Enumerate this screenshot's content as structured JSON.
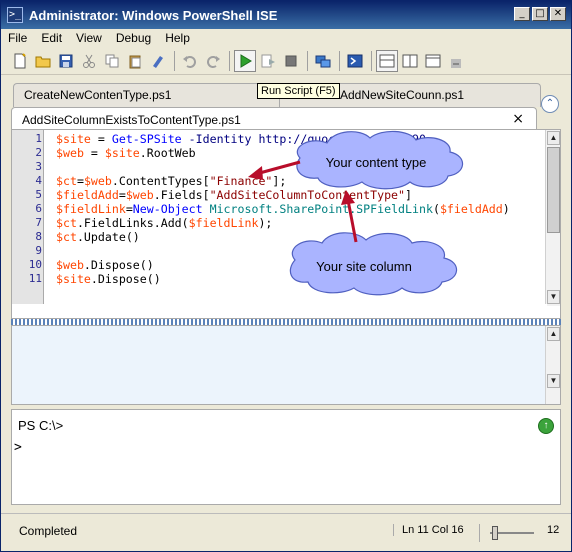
{
  "window": {
    "title": "Administrator: Windows PowerShell ISE",
    "app_icon_glyph": ">_"
  },
  "title_buttons": {
    "minimize": "_",
    "maximize": "□",
    "close": "✕"
  },
  "menu": [
    "File",
    "Edit",
    "View",
    "Debug",
    "Help"
  ],
  "toolbar": {
    "tools": [
      "new-icon",
      "open-icon",
      "save-icon",
      "cut-icon",
      "copy-icon",
      "paste-icon",
      "clear-icon",
      "undo-icon",
      "redo-icon",
      "run-icon",
      "run-selection-icon",
      "stop-icon",
      "remote-icon",
      "powershell-icon",
      "layout-top-icon",
      "layout-right-icon",
      "layout-max-icon"
    ],
    "tooltip": "Run Script (F5)"
  },
  "tabs": {
    "inactive": [
      "CreateNewContenType.ps1",
      "AddNewSiteCounn.ps1"
    ],
    "active": "AddSiteColumnExistsToContentType.ps1",
    "close_glyph": "×",
    "collapse_glyph": "⌃"
  },
  "editor": {
    "line_numbers": [
      "1",
      "2",
      "3",
      "4",
      "5",
      "6",
      "7",
      "8",
      "9",
      "10",
      "11"
    ],
    "lines": [
      [
        {
          "t": "$site",
          "c": "var"
        },
        {
          "t": " = ",
          "c": "plain"
        },
        {
          "t": "Get-SPSite",
          "c": "cmd"
        },
        {
          "t": " -Identity ",
          "c": "param"
        },
        {
          "t": "http://quochung-axioo:90",
          "c": "param"
        }
      ],
      [
        {
          "t": "$web",
          "c": "var"
        },
        {
          "t": " = ",
          "c": "plain"
        },
        {
          "t": "$site",
          "c": "var"
        },
        {
          "t": ".RootWeb",
          "c": "plain"
        }
      ],
      [],
      [
        {
          "t": "$ct",
          "c": "var"
        },
        {
          "t": "=",
          "c": "plain"
        },
        {
          "t": "$web",
          "c": "var"
        },
        {
          "t": ".ContentTypes[",
          "c": "plain"
        },
        {
          "t": "\"Finance\"",
          "c": "str"
        },
        {
          "t": "];",
          "c": "plain"
        }
      ],
      [
        {
          "t": "$fieldAdd",
          "c": "var"
        },
        {
          "t": "=",
          "c": "plain"
        },
        {
          "t": "$web",
          "c": "var"
        },
        {
          "t": ".Fields[",
          "c": "plain"
        },
        {
          "t": "\"AddSiteColumnToContentType\"",
          "c": "str"
        },
        {
          "t": "]",
          "c": "plain"
        }
      ],
      [
        {
          "t": "$fieldLink",
          "c": "var"
        },
        {
          "t": "=",
          "c": "plain"
        },
        {
          "t": "New-Object",
          "c": "cmd"
        },
        {
          "t": " Microsoft.SharePoint.SPFieldLink",
          "c": "type"
        },
        {
          "t": "(",
          "c": "plain"
        },
        {
          "t": "$fieldAdd",
          "c": "var"
        },
        {
          "t": ")",
          "c": "plain"
        }
      ],
      [
        {
          "t": "$ct",
          "c": "var"
        },
        {
          "t": ".FieldLinks.Add(",
          "c": "plain"
        },
        {
          "t": "$fieldLink",
          "c": "var"
        },
        {
          "t": ");",
          "c": "plain"
        }
      ],
      [
        {
          "t": "$ct",
          "c": "var"
        },
        {
          "t": ".Update()",
          "c": "plain"
        }
      ],
      [],
      [
        {
          "t": "$web",
          "c": "var"
        },
        {
          "t": ".Dispose()",
          "c": "plain"
        }
      ],
      [
        {
          "t": "$site",
          "c": "var"
        },
        {
          "t": ".Dispose()",
          "c": "plain"
        }
      ]
    ]
  },
  "callouts": {
    "content_type": "Your content type",
    "site_column": "Your site column"
  },
  "scroll": {
    "up": "▲",
    "down": "▼"
  },
  "console": {
    "prompt": "PS C:\\>",
    "caret": ">",
    "run_glyph": "↑"
  },
  "status": {
    "text": "Completed",
    "position": "Ln 11  Col 16",
    "zoom": "12"
  },
  "colors": {
    "callout_fill": "#aab4ff",
    "arrow": "#b80d2a"
  }
}
